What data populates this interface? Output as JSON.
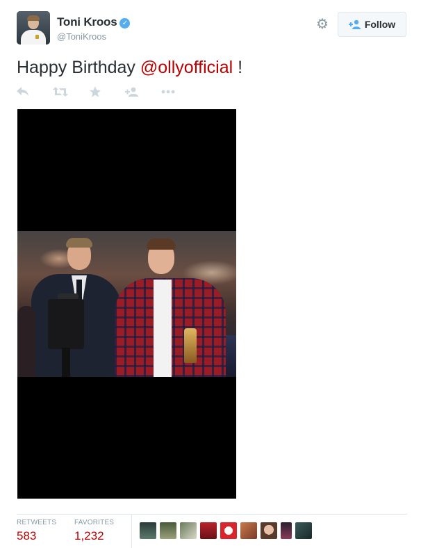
{
  "header": {
    "fullname": "Toni Kroos",
    "verified_icon": "verified-badge-icon",
    "username": "@ToniKroos",
    "gear_icon": "gear-icon",
    "follow_label": "Follow",
    "follow_icon": "add-user-icon"
  },
  "tweet": {
    "text_before": "Happy Birthday ",
    "mention": "@ollyofficial",
    "text_after": " !",
    "mention_color": "#ba0000"
  },
  "actions": [
    {
      "name": "reply-icon"
    },
    {
      "name": "retweet-icon"
    },
    {
      "name": "favorite-star-icon"
    },
    {
      "name": "follow-user-icon"
    },
    {
      "name": "more-dots-icon"
    }
  ],
  "media": {
    "background_color": "#000000"
  },
  "stats": {
    "retweets_label": "RETWEETS",
    "retweets_value": "583",
    "favorites_label": "FAVORITES",
    "favorites_value": "1,232",
    "value_color": "#ba0000"
  },
  "favoriters_count": 10,
  "colors": {
    "accent_blue": "#55acee",
    "text_dark": "#292f33",
    "muted": "#8899a6",
    "action_gray": "#ccd6dd"
  }
}
